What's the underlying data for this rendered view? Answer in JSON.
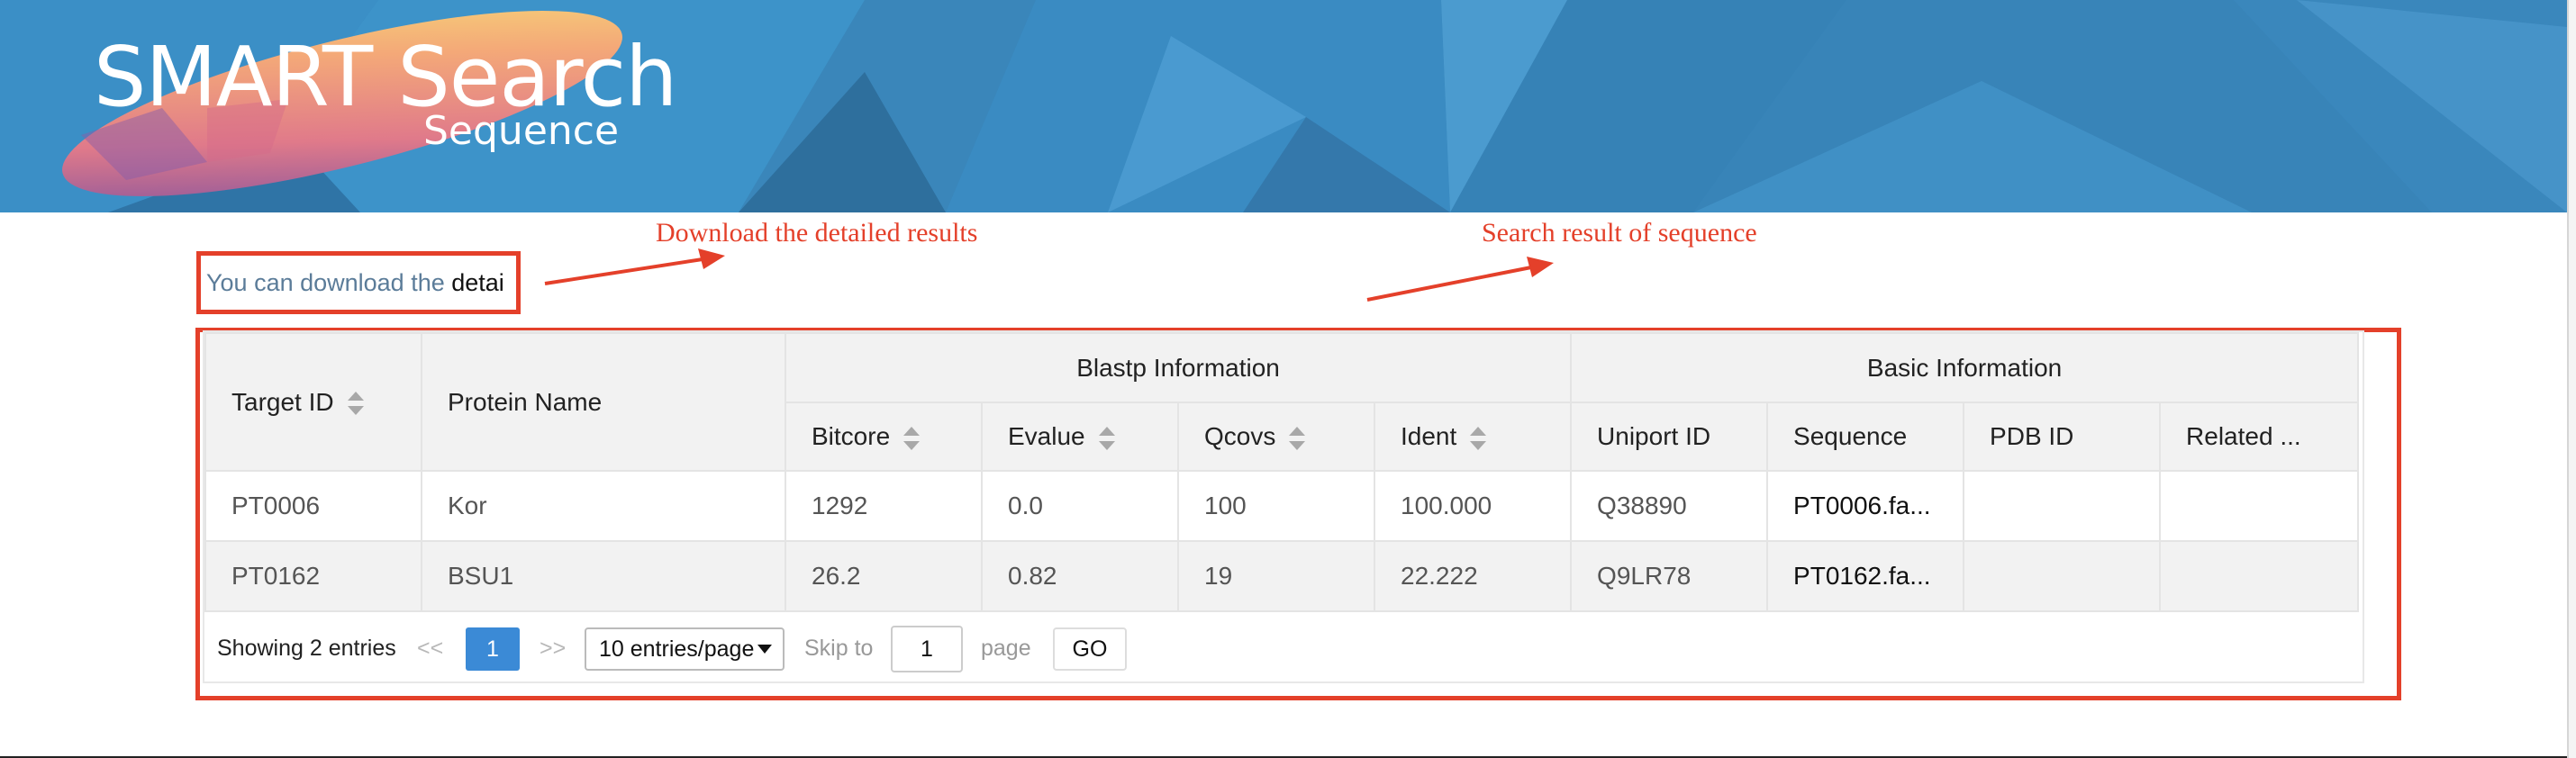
{
  "header": {
    "title": "SMART Search",
    "subtitle": "Sequence"
  },
  "download_prompt": {
    "lead": "You can download the",
    "tail": "detai"
  },
  "annotations": {
    "download": "Download the detailed results",
    "result": "Search result of sequence"
  },
  "table": {
    "columns": {
      "target_id": "Target ID",
      "protein_name": "Protein Name",
      "blastp_group": "Blastp Information",
      "basic_group": "Basic Information",
      "bitcore": "Bitcore",
      "evalue": "Evalue",
      "qcovs": "Qcovs",
      "ident": "Ident",
      "uniport_id": "Uniport ID",
      "sequence": "Sequence",
      "pdb_id": "PDB ID",
      "related": "Related ..."
    },
    "rows": [
      {
        "target_id": "PT0006",
        "protein_name": "Kor",
        "bitcore": "1292",
        "evalue": "0.0",
        "qcovs": "100",
        "ident": "100.000",
        "uniport_id": "Q38890",
        "sequence": "PT0006.fa...",
        "pdb_id": "",
        "related": ""
      },
      {
        "target_id": "PT0162",
        "protein_name": "BSU1",
        "bitcore": "26.2",
        "evalue": "0.82",
        "qcovs": "19",
        "ident": "22.222",
        "uniport_id": "Q9LR78",
        "sequence": "PT0162.fa...",
        "pdb_id": "",
        "related": ""
      }
    ]
  },
  "pagination": {
    "total_text": "Showing 2 entries",
    "prev": "<<",
    "current": "1",
    "next": ">>",
    "page_size": "10 entries/page",
    "skip_label": "Skip to",
    "skip_value": "1",
    "page_label": "page",
    "go": "GO"
  },
  "colors": {
    "banner": "#3a86bd",
    "annotation": "#e4402a",
    "pager_active": "#3b8ad6"
  }
}
